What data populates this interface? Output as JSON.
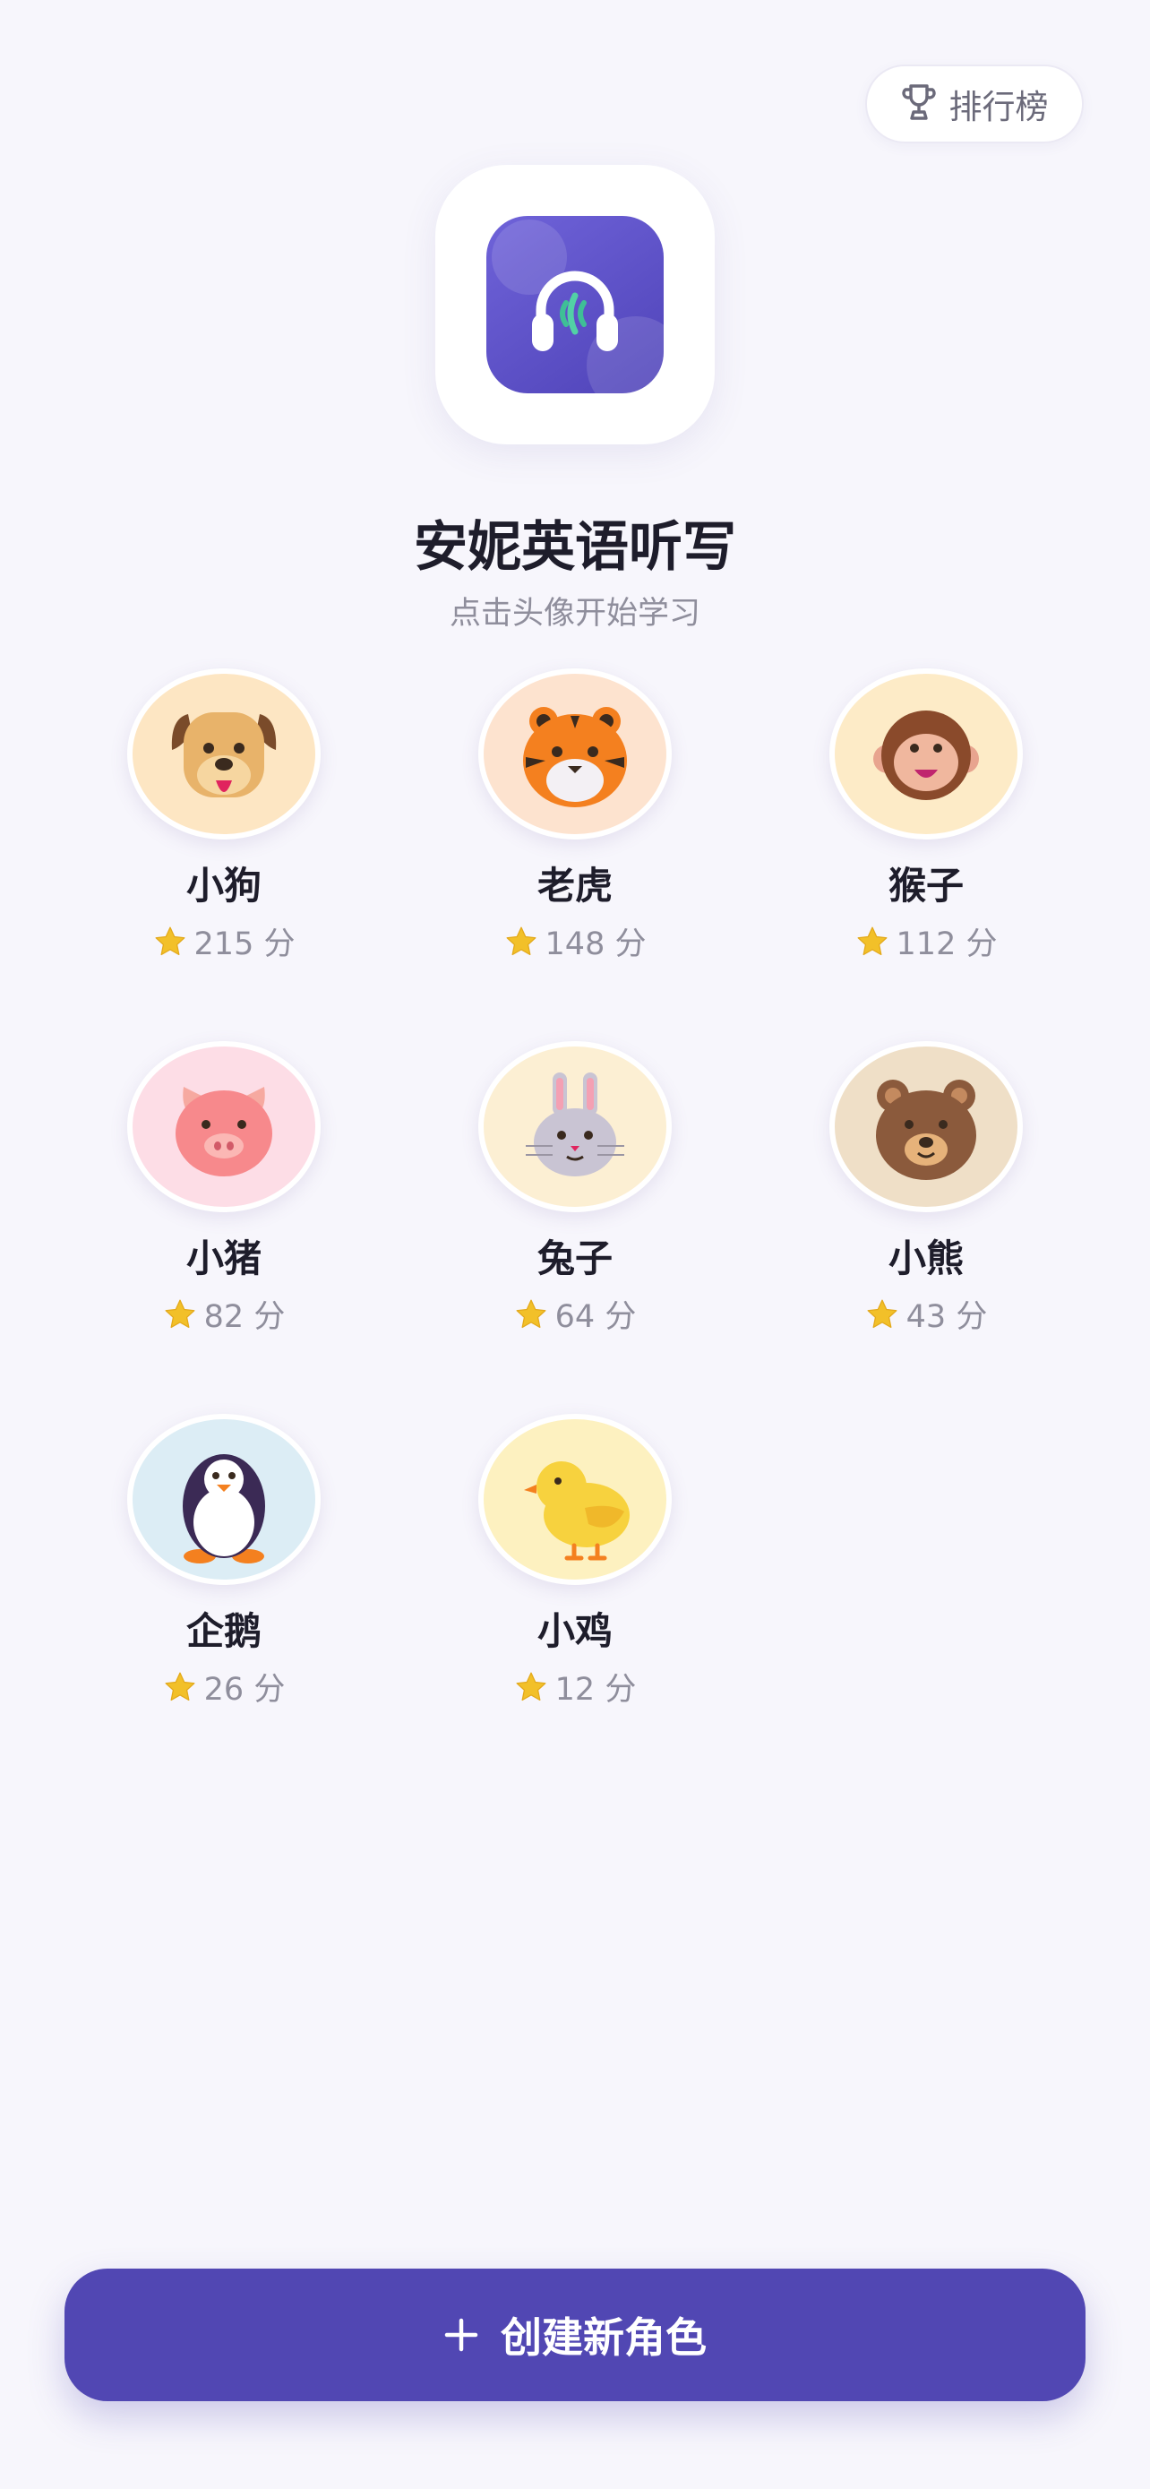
{
  "header": {
    "leaderboard_label": "排行榜"
  },
  "app": {
    "title": "安妮英语听写",
    "subtitle": "点击头像开始学习"
  },
  "characters": [
    {
      "name": "小狗",
      "score": "215 分",
      "icon": "dog-icon",
      "bg": "#fde6c3"
    },
    {
      "name": "老虎",
      "score": "148 分",
      "icon": "tiger-icon",
      "bg": "#fde3cf"
    },
    {
      "name": "猴子",
      "score": "112 分",
      "icon": "monkey-icon",
      "bg": "#fdebc7"
    },
    {
      "name": "小猪",
      "score": "82 分",
      "icon": "pig-icon",
      "bg": "#fddde6"
    },
    {
      "name": "兔子",
      "score": "64 分",
      "icon": "rabbit-icon",
      "bg": "#fcefd3"
    },
    {
      "name": "小熊",
      "score": "43 分",
      "icon": "bear-icon",
      "bg": "#efdfc7"
    },
    {
      "name": "企鹅",
      "score": "26 分",
      "icon": "penguin-icon",
      "bg": "#dcedf5"
    },
    {
      "name": "小鸡",
      "score": "12 分",
      "icon": "chick-icon",
      "bg": "#fdf1c0"
    }
  ],
  "footer": {
    "create_label": "创建新角色",
    "create_icon": "plus-icon"
  },
  "colors": {
    "accent": "#5147b3",
    "background": "#f7f6fc",
    "star": "#f2c029"
  }
}
